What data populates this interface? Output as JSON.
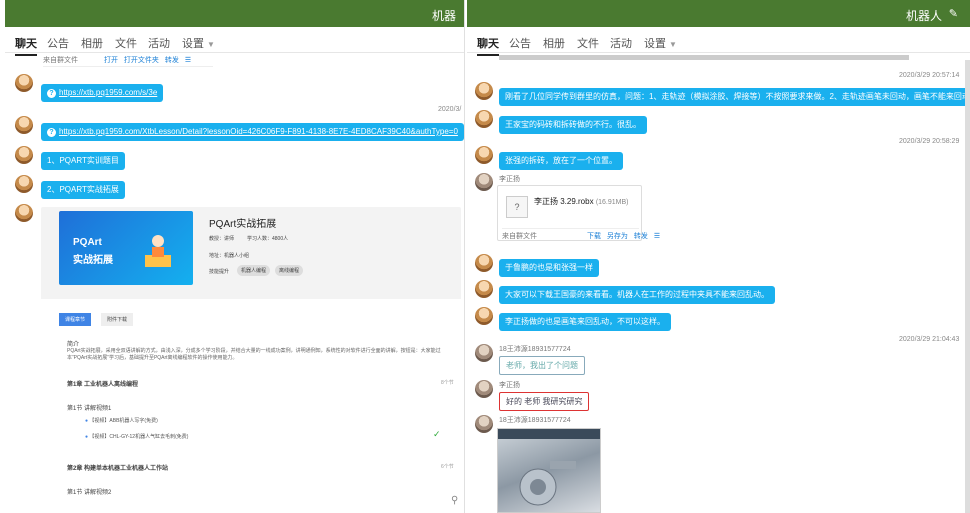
{
  "left": {
    "title": "机器",
    "tabs": [
      "聊天",
      "公告",
      "相册",
      "文件",
      "活动",
      "设置"
    ],
    "top_file_bar": {
      "from": "来自群文件",
      "open": "打开",
      "open_folder": "打开文件夹",
      "forward": "转发"
    },
    "link1": "https://xtb.pq1959.com/s/3e",
    "time1": "2020/3/",
    "link2": "https://xtb.pq1959.com/XtbLesson/Detail?lessonOid=426C06F9-F891-4138-8E7E-4ED8CAF39C40&authType=0",
    "msg1": "1、PQART实训题目",
    "msg2": "2、PQART实战拓展",
    "preview": {
      "banner_title": "PQArt",
      "banner_sub": "实战拓展",
      "course_title": "PQArt实战拓展",
      "meta1": "教授：讲师",
      "meta2": "学习人数：4800人",
      "meta3": "地址：机器人小组",
      "tag_label": "技能提升",
      "tag1": "机器人编程",
      "tag2": "离线编程",
      "tab_chapter": "课程章节",
      "tab_download": "附件下载",
      "intro_title": "简介",
      "intro_text": "PQArt实战拓展，采用全双语讲解的方式，由浅入深，分成多个学习阶段，并结合大量的一线成功案例，讲明通例知，系统性的对软件进行全面的讲解，按钮是：大家能过本“PQArt实战拓展”学习后，基础提升至PQArt离线编程软件的操作使用能力。",
      "ch1": "第1章 工业机器人离线编程",
      "ch1_count": "8个节",
      "sec1": "第1节 讲解视频1",
      "item1": "【视频】ABB机器人写字(免费)",
      "item2": "【视频】CHL-GY-12机器人气缸去毛刺(免费)",
      "ch2": "第2章 构建单本机器工业机器人工作站",
      "ch2_count": "6个节",
      "sec2": "第1节 讲解视频2"
    }
  },
  "right": {
    "title": "机器人",
    "tabs": [
      "聊天",
      "公告",
      "相册",
      "文件",
      "活动",
      "设置"
    ],
    "time1": "2020/3/29 20:57:14",
    "msg1": "刚看了几位同学传到群里的仿真，问题：1、走轨迹（模拟涂胶、焊接等）不按照要求来做。2、走轨迹画笔未回动，画笔不能来回动，要保持",
    "msg2": "王家宝的码砖和拆砖做的不行。很乱。",
    "time2": "2020/3/29 20:58:29",
    "msg3": "张强的拆砖，放在了一个位置。",
    "sender1": "李正扬",
    "file": {
      "name": "李正扬 3.29.robx",
      "size": "(16.91MB)",
      "from": "来自群文件",
      "download": "下载",
      "save_as": "另存为",
      "forward": "转发"
    },
    "msg4": "于鲁鹏的也是和张强一样",
    "msg5": "大家可以下载王国豪的来看看。机器人在工作的过程中夹具不能来回乱动。",
    "msg6": "李正扬做的也是画笔来回乱动，不可以这样。",
    "time3": "2020/3/29 21:04:43",
    "sender2": "18王沛源18931577724",
    "msg7": "老师，我出了个问题",
    "sender3": "李正扬",
    "msg8": "好的  老师  我研究研究",
    "sender4": "18王沛源18931577724"
  }
}
